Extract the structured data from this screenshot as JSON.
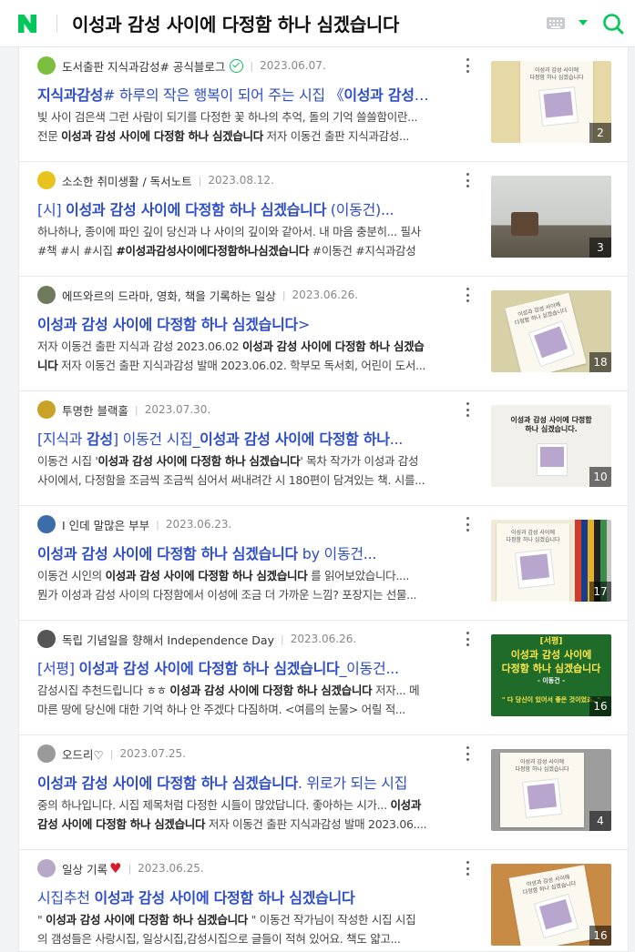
{
  "header": {
    "logo_letter": "N",
    "query": "이성과 감성 사이에 다정함 하나 심겠습니다",
    "brand_color": "#03c75a",
    "keyboard_icon": "keyboard-icon",
    "search_icon": "search-icon"
  },
  "results": [
    {
      "source": "도서출판 지식과감성# 공식블로그",
      "verified": true,
      "date": "2023.06.07.",
      "title_parts": [
        {
          "t": "지식과감성",
          "b": true
        },
        {
          "t": "# 하루의 작은 행복이 되어 주는 시집 《",
          "b": false
        },
        {
          "t": "이성과 감성",
          "b": true
        },
        {
          "t": "…",
          "b": false
        }
      ],
      "desc_lines": [
        [
          {
            "t": "빛 사이 검은색 그런 사람이 되기를 다정한 꽃 하나의 추억, 돌의 기억 쓸쓸함이란...",
            "b": false
          }
        ],
        [
          {
            "t": "전문 ",
            "b": false
          },
          {
            "t": "이성과 감성 사이에 다정함 하나 심겠습니다",
            "b": true
          },
          {
            "t": " 저자 이동건 출판 지식과감성...",
            "b": false
          }
        ]
      ],
      "count": "2",
      "avatar_color": "#7bbf3e"
    },
    {
      "source": "소소한 취미생활 / 독서노트",
      "verified": false,
      "date": "2023.08.12.",
      "title_parts": [
        {
          "t": "[시] ",
          "b": false
        },
        {
          "t": "이성과 감성 사이에 다정함 하나 심겠습니다",
          "b": true
        },
        {
          "t": " (이동건)...",
          "b": false
        }
      ],
      "desc_lines": [
        [
          {
            "t": "하나하나, 종이에 파인 깊이 당신과 나 사이의 깊이와 같아서. 내 마음 충분히... 필사",
            "b": false
          }
        ],
        [
          {
            "t": "#책 #시 #시집 ",
            "b": false
          },
          {
            "t": "#이성과감성사이에다정함하나심겠습니다",
            "b": true
          },
          {
            "t": " #이동건 #지식과감성",
            "b": false
          }
        ]
      ],
      "count": "3",
      "avatar_color": "#e8c31e"
    },
    {
      "source": "에뜨와르의 드라마, 영화, 책을 기록하는 일상",
      "verified": false,
      "date": "2023.06.26.",
      "title_parts": [
        {
          "t": "이성과 감성 사이에 다정함 하나 심겠습니다",
          "b": true
        },
        {
          "t": ">",
          "b": false
        }
      ],
      "desc_lines": [
        [
          {
            "t": "저자 이동건 출판 지식과 감성 2023.06.02 ",
            "b": false
          },
          {
            "t": "이성과 감성 사이에 다정함 하나 심겠습",
            "b": true
          }
        ],
        [
          {
            "t": "니다",
            "b": true
          },
          {
            "t": " 저자 이동건 출판 지식과감성 발매 2023.06.02. 학부모 독서회, 어린이 도서...",
            "b": false
          }
        ]
      ],
      "count": "18",
      "avatar_color": "#6d7a5c"
    },
    {
      "source": "투명한 블랙홀",
      "verified": false,
      "date": "2023.07.30.",
      "title_parts": [
        {
          "t": "[지식과 ",
          "b": false
        },
        {
          "t": "감성",
          "b": true
        },
        {
          "t": "] 이동건 시집_",
          "b": false
        },
        {
          "t": "이성과 감성 사이에 다정함 하나",
          "b": true
        },
        {
          "t": "...",
          "b": false
        }
      ],
      "desc_lines": [
        [
          {
            "t": "이동건 시집 '",
            "b": false
          },
          {
            "t": "이성과 감성 사이에 다정함 하나 심겠습니다",
            "b": true
          },
          {
            "t": "' 목차 작가가 이성과 감성",
            "b": false
          }
        ],
        [
          {
            "t": "사이에서, 다정함을 조금씩 조금씩 심어서 써내려간 시 180편이 담겨있는 책. 시를...",
            "b": false
          }
        ]
      ],
      "count": "10",
      "avatar_color": "#c9a227"
    },
    {
      "source": "I 인데 말많은 부부",
      "verified": false,
      "date": "2023.06.23.",
      "title_parts": [
        {
          "t": "이성과 감성 사이에 다정함 하나 심겠습니다",
          "b": true
        },
        {
          "t": " by 이동건...",
          "b": false
        }
      ],
      "desc_lines": [
        [
          {
            "t": "이동건 시인의 ",
            "b": false
          },
          {
            "t": "이성과 감성 사이에 다정함 하나 심겠습니다",
            "b": true
          },
          {
            "t": " 를 읽어보았습니다....",
            "b": false
          }
        ],
        [
          {
            "t": "뭔가 이성과 감성 사이의 다정함에서 이성에 조금 더 가까운 느낌? 포장지는 선물...",
            "b": false
          }
        ]
      ],
      "count": "17",
      "avatar_color": "#3b6ea8"
    },
    {
      "source": "독립 기념일을 향해서 Independence Day",
      "verified": false,
      "date": "2023.06.26.",
      "title_parts": [
        {
          "t": "[서평] ",
          "b": false
        },
        {
          "t": "이성과 감성 사이에 다정함 하나 심겠습니다",
          "b": true
        },
        {
          "t": "_이동건...",
          "b": false
        }
      ],
      "desc_lines": [
        [
          {
            "t": "감성시집 추천드립니다 ㅎㅎ ",
            "b": false
          },
          {
            "t": "이성과 감성 사이에 다정함 하나 심겠습니다",
            "b": true
          },
          {
            "t": " 저자... 메",
            "b": false
          }
        ],
        [
          {
            "t": "마른 땅에 당신에 대한 기억 하나 안 주겠다 다짐하며. <여름의 눈물> 어릴 적...",
            "b": false
          }
        ]
      ],
      "count": "16",
      "avatar_color": "#555555",
      "thumb_text": {
        "tag": "[서평]",
        "line1": "이성과 감성 사이에",
        "line2": "다정함 하나 심겠습니다",
        "author": "- 이동건 -",
        "quote": "\" 다 당신이 있어서 좋은 것이었죠. \""
      }
    },
    {
      "source": "오드리♡",
      "verified": false,
      "date": "2023.07.25.",
      "title_parts": [
        {
          "t": "이성과 감성 사이에 다정함 하나 심겠습니다",
          "b": true
        },
        {
          "t": ". 위로가 되는 시집",
          "b": false
        }
      ],
      "desc_lines": [
        [
          {
            "t": "중의 하나입니다. 시집 제목처럼 다정한 시들이 많았답니다. 좋아하는 시가... ",
            "b": false
          },
          {
            "t": "이성과",
            "b": true
          }
        ],
        [
          {
            "t": "감성 사이에 다정함 하나 심겠습니다",
            "b": true
          },
          {
            "t": " 저자 이동건 출판 지식과감성 발매 2023.06....",
            "b": false
          }
        ]
      ],
      "count": "4",
      "avatar_color": "#9a9a9a"
    },
    {
      "source": "일상 기록",
      "heart": true,
      "verified": false,
      "date": "2023.06.25.",
      "title_parts": [
        {
          "t": "시집추천 ",
          "b": false
        },
        {
          "t": "이성과 감성 사이에 다정함 하나 심겠습니다",
          "b": true
        }
      ],
      "desc_lines": [
        [
          {
            "t": "\" ",
            "b": false
          },
          {
            "t": "이성과 감성 사이에 다정함 하나 심겠습니다",
            "b": true
          },
          {
            "t": " \" 이동건 작가님이 작성한 시집 시집",
            "b": false
          }
        ],
        [
          {
            "t": "의 갬성들은 사랑시집, 일상시집,감성시집으로 글들이 적혀 있어요. 책도 얇고...",
            "b": false
          }
        ]
      ],
      "count": "16",
      "avatar_color": "#b8a8c8"
    }
  ],
  "book_cover_title_lines": [
    "이성과 감성 사이에",
    "다정함 하나 심겠습니다"
  ],
  "thumb4_title_lines": [
    "이성과 감성 사이에 다정함",
    "하나 심겠습니다."
  ]
}
